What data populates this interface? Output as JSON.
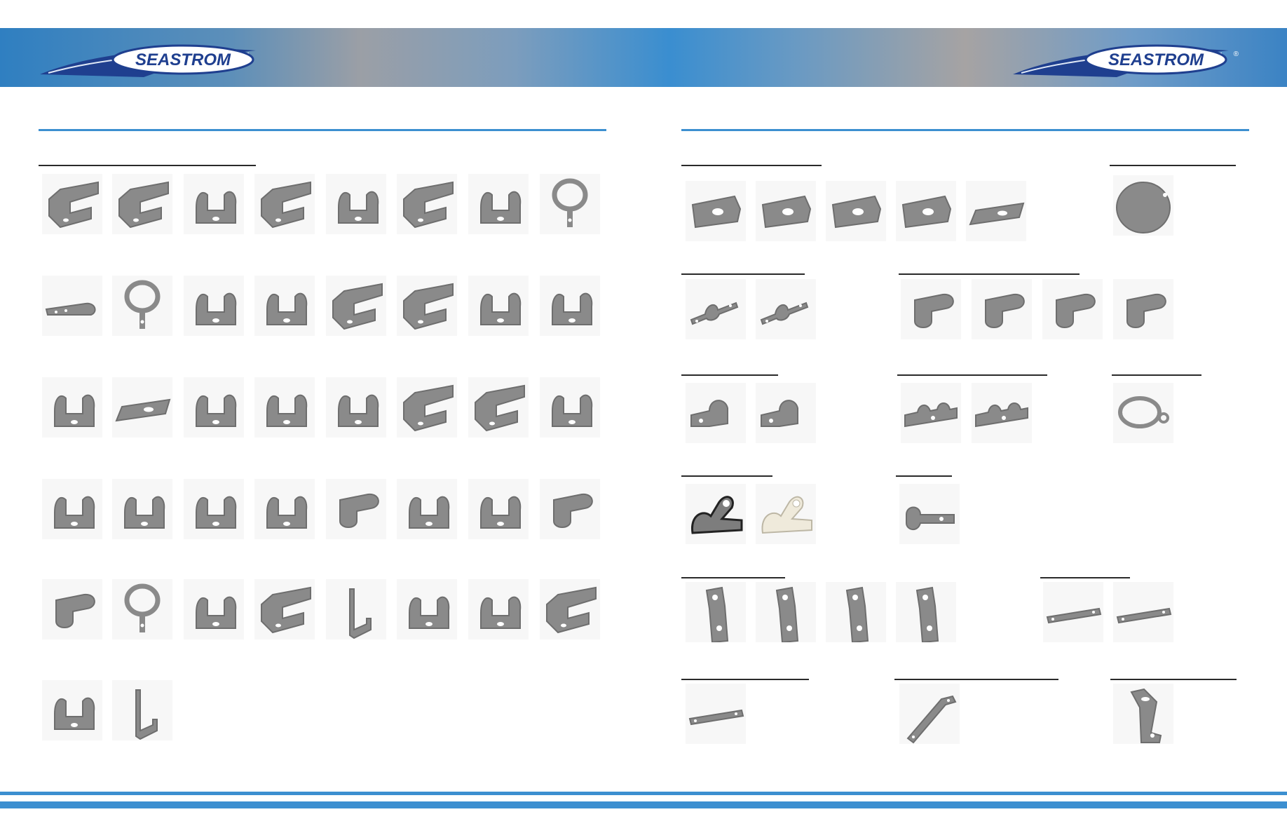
{
  "brand": {
    "name": "SEASTROM",
    "registered_mark": "®",
    "colors": {
      "header_blue": "#3c8fd0",
      "logo_navy": "#1f3f8f",
      "part_gray": "#8a8a8a",
      "rule": "#2a2a2a"
    }
  },
  "left_page": {
    "category_title": "",
    "parts_icon": "spring-clip-icon",
    "rows": 6,
    "part_count": 42
  },
  "right_page": {
    "categories": [
      {
        "id": "mounting-plates",
        "title": "",
        "part_count": 5,
        "icon": "mounting-plate-icon"
      },
      {
        "id": "round-tag",
        "title": "",
        "part_count": 1,
        "icon": "round-tag-icon"
      },
      {
        "id": "strap-clamps",
        "title": "",
        "part_count": 2,
        "icon": "strap-clamp-icon"
      },
      {
        "id": "formed-clips",
        "title": "",
        "part_count": 4,
        "icon": "formed-clip-icon"
      },
      {
        "id": "single-loop-clamps",
        "title": "",
        "part_count": 2,
        "icon": "loop-clamp-icon"
      },
      {
        "id": "double-loop-clamps",
        "title": "",
        "part_count": 2,
        "icon": "loop-clamp-icon"
      },
      {
        "id": "band-clamp",
        "title": "",
        "part_count": 1,
        "icon": "band-clamp-icon"
      },
      {
        "id": "cushion-clamps",
        "title": "",
        "part_count": 2,
        "icon": "cushion-clamp-icon"
      },
      {
        "id": "p-clamp",
        "title": "",
        "part_count": 1,
        "icon": "p-clamp-icon"
      },
      {
        "id": "angle-brackets",
        "title": "",
        "part_count": 4,
        "icon": "angle-bracket-icon"
      },
      {
        "id": "flat-links",
        "title": "",
        "part_count": 2,
        "icon": "flat-link-icon"
      },
      {
        "id": "flat-bar",
        "title": "",
        "part_count": 1,
        "icon": "flat-bar-icon"
      },
      {
        "id": "angle-link",
        "title": "",
        "part_count": 1,
        "icon": "angle-link-icon"
      },
      {
        "id": "offset-bracket",
        "title": "",
        "part_count": 1,
        "icon": "offset-bracket-icon"
      }
    ]
  }
}
